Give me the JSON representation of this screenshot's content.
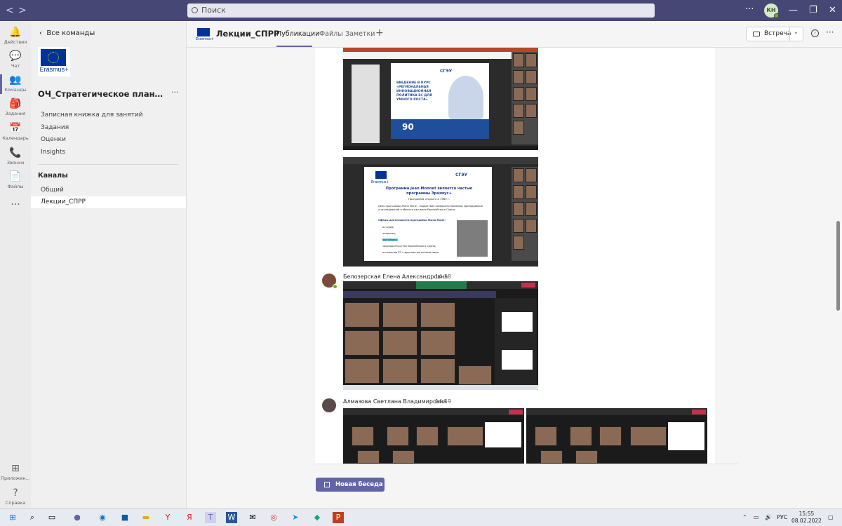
{
  "titlebar": {
    "search_placeholder": "Поиск",
    "user_initials": "КН",
    "more": "···"
  },
  "rail": [
    {
      "label": "Действия",
      "icon": "bell-icon",
      "glyph": "🔔"
    },
    {
      "label": "Чат",
      "icon": "chat-icon",
      "glyph": "💬"
    },
    {
      "label": "Команды",
      "icon": "teams-icon",
      "glyph": "👥"
    },
    {
      "label": "Задания",
      "icon": "assignments-icon",
      "glyph": "🎒"
    },
    {
      "label": "Календарь",
      "icon": "calendar-icon",
      "glyph": "📅"
    },
    {
      "label": "Звонки",
      "icon": "phone-icon",
      "glyph": "📞"
    },
    {
      "label": "Файлы",
      "icon": "files-icon",
      "glyph": "📄"
    },
    {
      "label": "",
      "icon": "more-icon",
      "glyph": "···"
    },
    {
      "label": "Приложен...",
      "icon": "apps-icon",
      "glyph": "⊞"
    },
    {
      "label": "Справка",
      "icon": "help-icon",
      "glyph": "?"
    }
  ],
  "sidebar": {
    "back_label": "Все команды",
    "logo_text": "Erasmus+",
    "team_name": "ОЧ_Стратегическое планирова...",
    "team_more": "···",
    "links": [
      "Записная книжка для занятий",
      "Задания",
      "Оценки",
      "Insights"
    ],
    "channels_heading": "Каналы",
    "channels": [
      "Общий",
      "Лекции_СПРР"
    ]
  },
  "header": {
    "channel_icon_text": "Erasmus+",
    "title": "Лекции_СПРР",
    "tabs": [
      "Публикации",
      "Файлы",
      "Заметки"
    ],
    "add_tab": "+",
    "meet_label": "Встреча",
    "meet_caret": "⌄",
    "info": "i",
    "more": "···"
  },
  "feed": {
    "messages": [
      {
        "author": "Белозерская Елена Александровна",
        "time": "14:58"
      },
      {
        "author": "Алмазова Светлана Владимировна",
        "time": "14:59"
      }
    ],
    "slide1": {
      "logo": "СГЭУ",
      "title": "ВВЕДЕНИЕ В КУРС «РЕГИОНАЛЬНАЯ ИННОВАЦИОННАЯ ПОЛИТИКА ЕС ДЛЯ УМНОГО РОСТА»",
      "badge": "90"
    },
    "slide2": {
      "logo": "СГЭУ",
      "eu_text": "Erasmus+",
      "title": "Программа Jean Monnet является частью программы Эразмус+",
      "subtitle": "Программа открыта в 1989 г.",
      "goal": "Цель программы Жана Моне - содействие совершенствованию преподавания и исследований в области изучения Европейского Союза",
      "spheres_heading": "Сферы деятельности программы Жана Моне:",
      "spheres": [
        "история;",
        "политика;",
        "экономика;",
        "законодательство Европейского Союза;",
        "отношения ЕС с другими регионами мира."
      ]
    }
  },
  "new_conversation": "Новая беседа",
  "taskbar": {
    "lang": "РУС",
    "time": "15:55",
    "date": "08.02.2022"
  }
}
